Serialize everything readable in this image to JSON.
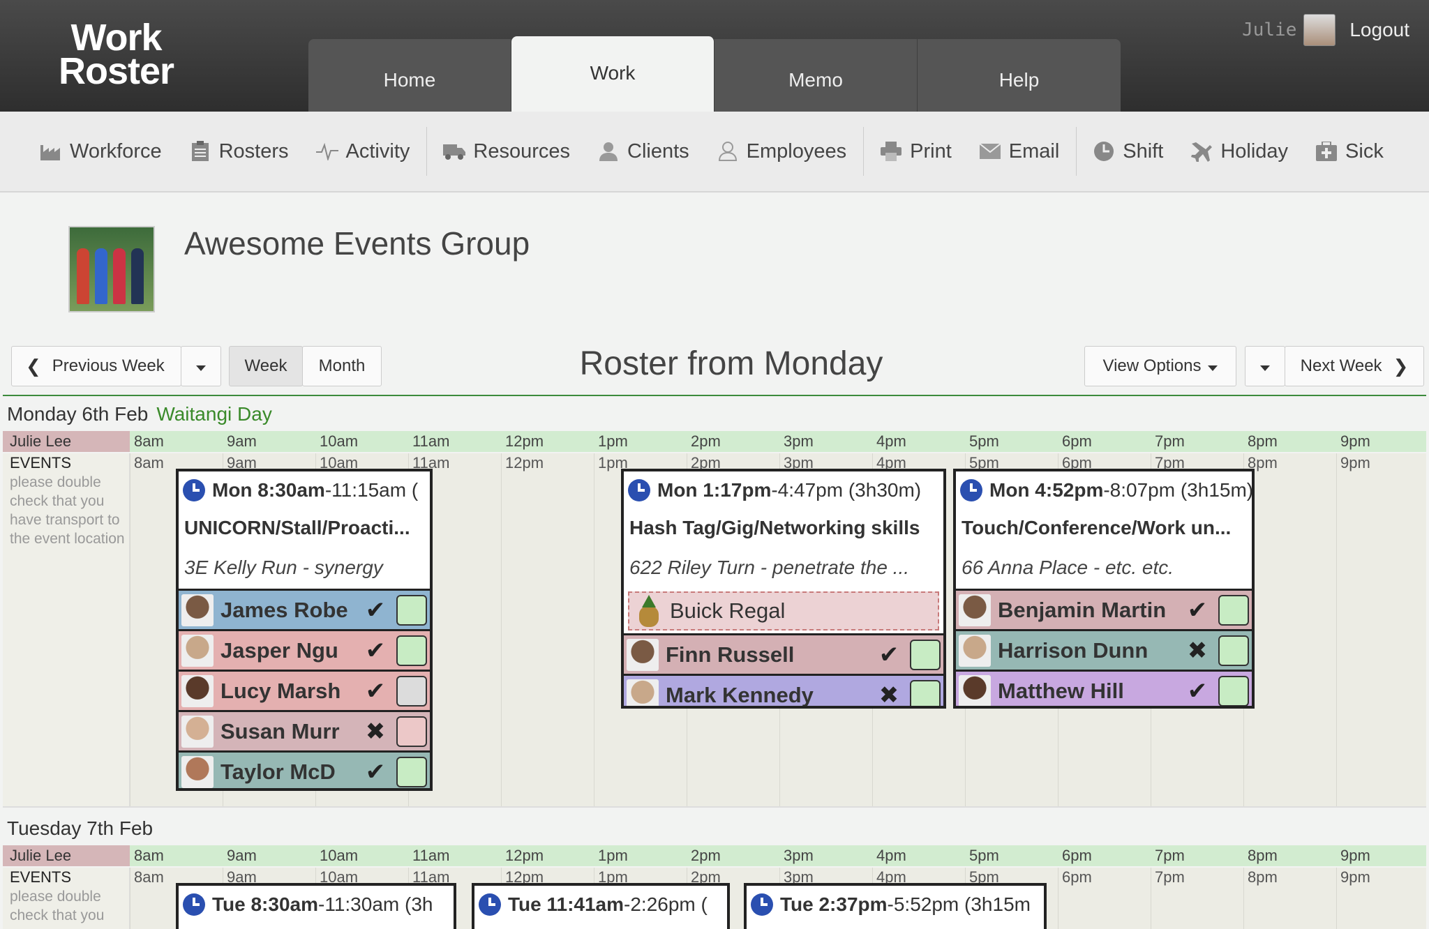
{
  "app": {
    "logo_line1": "Work",
    "logo_line2": "Roster"
  },
  "tabs": [
    {
      "label": "Home"
    },
    {
      "label": "Work"
    },
    {
      "label": "Memo"
    },
    {
      "label": "Help"
    }
  ],
  "user": {
    "name": "Julie",
    "logout": "Logout"
  },
  "toolbar": [
    {
      "label": "Workforce",
      "icon": "factory-icon"
    },
    {
      "label": "Rosters",
      "icon": "clipboard-icon"
    },
    {
      "label": "Activity",
      "icon": "pulse-icon"
    },
    {
      "label": "Resources",
      "icon": "truck-icon"
    },
    {
      "label": "Clients",
      "icon": "client-icon"
    },
    {
      "label": "Employees",
      "icon": "user-icon"
    },
    {
      "label": "Print",
      "icon": "printer-icon"
    },
    {
      "label": "Email",
      "icon": "envelope-icon"
    },
    {
      "label": "Shift",
      "icon": "clock-icon"
    },
    {
      "label": "Holiday",
      "icon": "plane-icon"
    },
    {
      "label": "Sick",
      "icon": "medkit-icon"
    }
  ],
  "org": {
    "name": "Awesome Events Group"
  },
  "nav": {
    "previous": "Previous Week",
    "week": "Week",
    "month": "Month",
    "title": "Roster from Monday",
    "view_options": "View Options",
    "next": "Next Week"
  },
  "hours": [
    "8am",
    "9am",
    "10am",
    "11am",
    "12pm",
    "1pm",
    "2pm",
    "3pm",
    "4pm",
    "5pm",
    "6pm",
    "7pm",
    "8pm",
    "9pm"
  ],
  "days": [
    {
      "title": "Monday 6th Feb",
      "holiday": "Waitangi Day",
      "manager": "Julie Lee",
      "group": "EVENTS",
      "note": "please double check that you have transport to the event location",
      "shifts": [
        {
          "day": "Mon",
          "start": "8:30am",
          "rest": "-11:15am (",
          "title": "UNICORN/Stall/Proacti...",
          "location": "3E Kelly Run - synergy",
          "people": [
            {
              "name": "James Robe",
              "mark": "check",
              "bg": "#8fb4d0",
              "box": "#c8ecc4"
            },
            {
              "name": "Jasper Ngu",
              "mark": "check",
              "bg": "#e4b0b0",
              "box": "#c8ecc4"
            },
            {
              "name": "Lucy Marsh",
              "mark": "check",
              "bg": "#e4b0b0",
              "box": "#dcdcdc"
            },
            {
              "name": "Susan Murr",
              "mark": "cross",
              "bg": "#d4b4b8",
              "box": "#ecc8c8"
            },
            {
              "name": "Taylor McD",
              "mark": "check",
              "bg": "#96b8b4",
              "box": "#c8ecc4"
            }
          ]
        },
        {
          "day": "Mon",
          "start": "1:17pm",
          "rest": "-4:47pm (3h30m)",
          "title": "Hash Tag/Gig/Networking skills",
          "location": "622 Riley Turn - penetrate the ...",
          "vehicle": "Buick Regal",
          "people": [
            {
              "name": "Finn Russell",
              "mark": "check",
              "bg": "#d4b0b4",
              "box": "#c8ecc4"
            },
            {
              "name": "Mark Kennedy",
              "mark": "cross",
              "bg": "#b0a8e0",
              "box": "#c8ecc4"
            }
          ]
        },
        {
          "day": "Mon",
          "start": "4:52pm",
          "rest": "-8:07pm (3h15m)",
          "title": "Touch/Conference/Work un...",
          "location": "66 Anna Place - etc. etc.",
          "people": [
            {
              "name": "Benjamin Martin",
              "mark": "check",
              "bg": "#d4b0b4",
              "box": "#c8ecc4"
            },
            {
              "name": "Harrison Dunn",
              "mark": "cross",
              "bg": "#96b8b4",
              "box": "#c8ecc4"
            },
            {
              "name": "Matthew Hill",
              "mark": "check",
              "bg": "#c8a8e0",
              "box": "#c8ecc4"
            }
          ]
        }
      ]
    },
    {
      "title": "Tuesday 7th Feb",
      "holiday": "",
      "manager": "Julie Lee",
      "group": "EVENTS",
      "note": "please double check that you",
      "shifts": [
        {
          "day": "Tue",
          "start": "8:30am",
          "rest": "-11:30am (3h"
        },
        {
          "day": "Tue",
          "start": "11:41am",
          "rest": "-2:26pm ("
        },
        {
          "day": "Tue",
          "start": "2:37pm",
          "rest": "-5:52pm (3h15m"
        }
      ]
    }
  ]
}
